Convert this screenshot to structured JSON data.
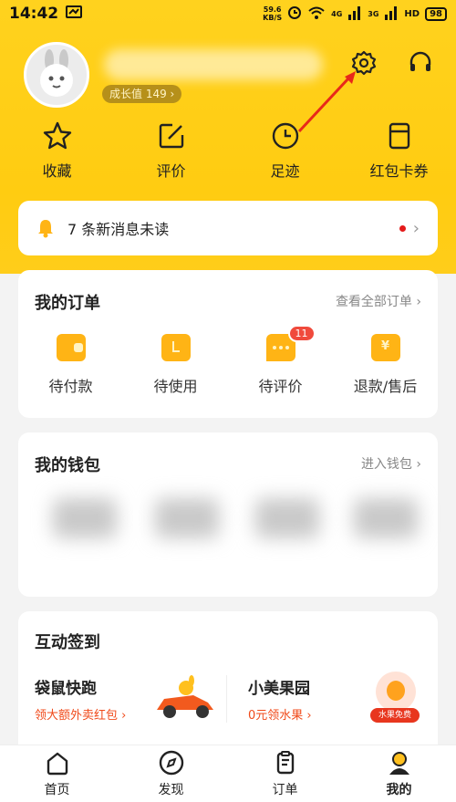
{
  "status": {
    "time": "14:42",
    "net_speed_top": "59.6",
    "net_speed_unit": "KB/S",
    "signal1": "4G",
    "signal2": "3G",
    "hd": "HD",
    "battery": "98"
  },
  "profile": {
    "growth": "成长值 149 ›"
  },
  "quick": [
    {
      "label": "收藏",
      "icon": "star-icon"
    },
    {
      "label": "评价",
      "icon": "edit-icon"
    },
    {
      "label": "足迹",
      "icon": "clock-icon"
    },
    {
      "label": "红包卡券",
      "icon": "coupon-icon"
    }
  ],
  "messages": {
    "text": "7 条新消息未读",
    "chevron": "›"
  },
  "orders": {
    "title": "我的订单",
    "link": "查看全部订单 ›",
    "items": [
      {
        "label": "待付款",
        "icon": "wallet-icon"
      },
      {
        "label": "待使用",
        "icon": "ticket-icon"
      },
      {
        "label": "待评价",
        "icon": "comment-icon",
        "badge": "11"
      },
      {
        "label": "退款/售后",
        "icon": "refund-icon"
      }
    ]
  },
  "wallet": {
    "title": "我的钱包",
    "link": "进入钱包 ›"
  },
  "checkin": {
    "title": "互动签到",
    "left_name": "袋鼠快跑",
    "left_sub": "领大额外卖红包 ›",
    "right_name": "小美果园",
    "right_sub": "0元领水果 ›",
    "right_badge": "水果免费"
  },
  "tabs": [
    {
      "label": "首页",
      "icon": "home-icon"
    },
    {
      "label": "发现",
      "icon": "compass-icon"
    },
    {
      "label": "订单",
      "icon": "order-list-icon"
    },
    {
      "label": "我的",
      "icon": "profile-icon"
    }
  ],
  "colors": {
    "brand_yellow": "#ffd21e",
    "accent_orange": "#ffb415",
    "badge_red": "#f04a3c"
  }
}
